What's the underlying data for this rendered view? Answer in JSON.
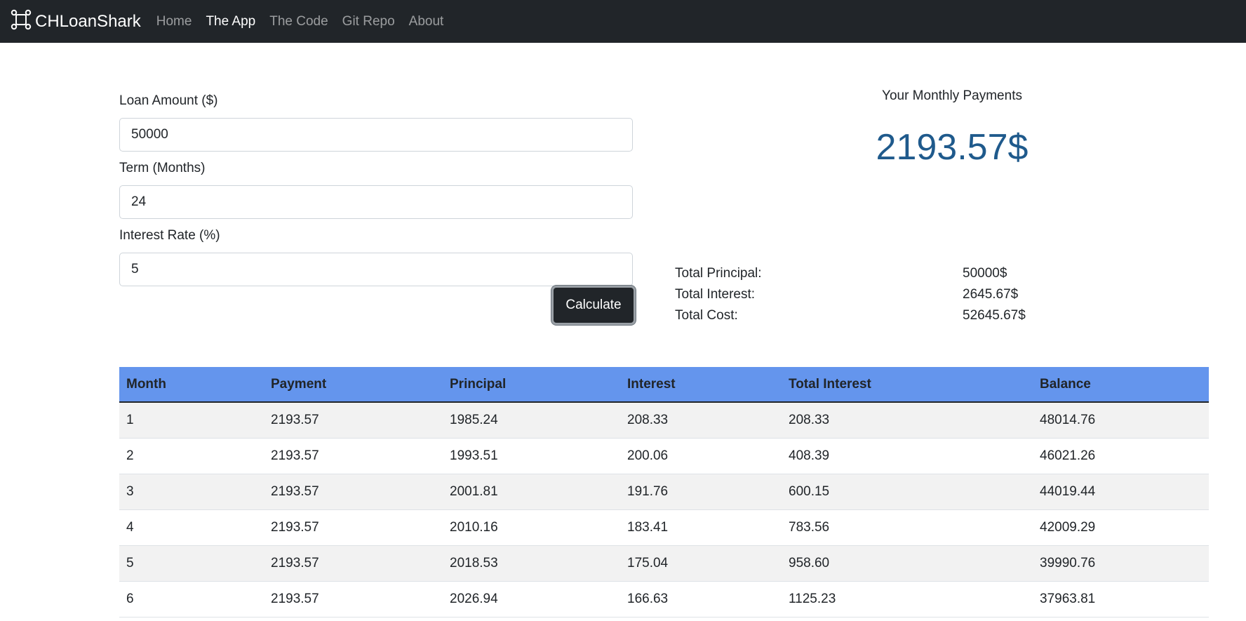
{
  "nav": {
    "brand": "CHLoanShark",
    "links": [
      "Home",
      "The App",
      "The Code",
      "Git Repo",
      "About"
    ],
    "active": "The App"
  },
  "form": {
    "loan_label": "Loan Amount ($)",
    "loan_value": "50000",
    "term_label": "Term (Months)",
    "term_value": "24",
    "rate_label": "Interest Rate (%)",
    "rate_value": "5",
    "calculate_label": "Calculate"
  },
  "results": {
    "title": "Your Monthly Payments",
    "monthly_payment": "2193.57$",
    "summary": [
      {
        "label": "Total Principal:",
        "value": "50000$"
      },
      {
        "label": "Total Interest:",
        "value": "2645.67$"
      },
      {
        "label": "Total Cost:",
        "value": "52645.67$"
      }
    ]
  },
  "table": {
    "headers": [
      "Month",
      "Payment",
      "Principal",
      "Interest",
      "Total Interest",
      "Balance"
    ],
    "rows": [
      [
        "1",
        "2193.57",
        "1985.24",
        "208.33",
        "208.33",
        "48014.76"
      ],
      [
        "2",
        "2193.57",
        "1993.51",
        "200.06",
        "408.39",
        "46021.26"
      ],
      [
        "3",
        "2193.57",
        "2001.81",
        "191.76",
        "600.15",
        "44019.44"
      ],
      [
        "4",
        "2193.57",
        "2010.16",
        "183.41",
        "783.56",
        "42009.29"
      ],
      [
        "5",
        "2193.57",
        "2018.53",
        "175.04",
        "958.60",
        "39990.76"
      ],
      [
        "6",
        "2193.57",
        "2026.94",
        "166.63",
        "1125.23",
        "37963.81"
      ]
    ]
  },
  "colors": {
    "navbar_bg": "#212529",
    "table_header_bg": "#6495ed",
    "monthly_amount": "#1f5a8c"
  }
}
